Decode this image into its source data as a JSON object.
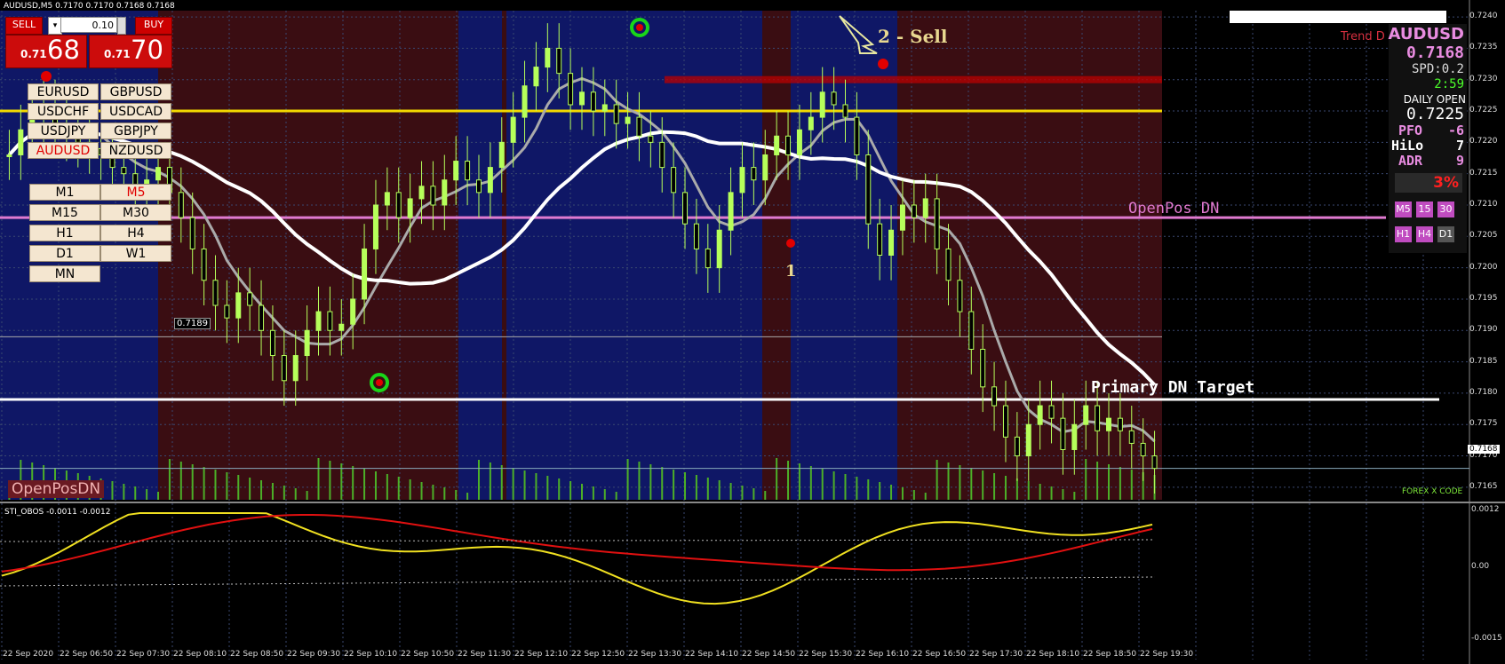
{
  "window": {
    "title": "AUDUSD,M5  0.7170 0.7170 0.7168 0.7168"
  },
  "trade_panel": {
    "sell_label": "SELL",
    "buy_label": "BUY",
    "lot": "0.10",
    "sell_small": "0.71",
    "sell_big": "68",
    "buy_small": "0.71",
    "buy_big": "70"
  },
  "currency_buttons": [
    "EURUSD",
    "GBPUSD",
    "USDCHF",
    "USDCAD",
    "USDJPY",
    "GBPJPY",
    "AUDUSD",
    "NZDUSD"
  ],
  "timeframe_buttons": [
    "M1",
    "M5",
    "M15",
    "M30",
    "H1",
    "H4",
    "D1",
    "W1",
    "MN"
  ],
  "selected_currency": "AUDUSD",
  "selected_timeframe": "M5",
  "price_axis": [
    "0.7240",
    "0.7235",
    "0.7230",
    "0.7225",
    "0.7220",
    "0.7215",
    "0.7210",
    "0.7205",
    "0.7200",
    "0.7195",
    "0.7190",
    "0.7185",
    "0.7180",
    "0.7175",
    "0.7170",
    "0.7165"
  ],
  "current_price_tag": "0.7168",
  "level_tag": "0.7189",
  "time_axis": [
    "22 Sep 2020",
    "22 Sep 06:50",
    "22 Sep 07:30",
    "22 Sep 08:10",
    "22 Sep 08:50",
    "22 Sep 09:30",
    "22 Sep 10:10",
    "22 Sep 10:50",
    "22 Sep 11:30",
    "22 Sep 12:10",
    "22 Sep 12:50",
    "22 Sep 13:30",
    "22 Sep 14:10",
    "22 Sep 14:50",
    "22 Sep 15:30",
    "22 Sep 16:10",
    "22 Sep 16:50",
    "22 Sep 17:30",
    "22 Sep 18:10",
    "22 Sep 18:50",
    "22 Sep 19:30"
  ],
  "annotations": {
    "sell": "2 - Sell",
    "one": "1",
    "openpos": "OpenPos DN",
    "primary": "Primary DN Target",
    "trend": "Trend D",
    "openpos_badge": "OpenPosDN",
    "brand": "FOREX X CODE"
  },
  "info_panel": {
    "symbol": "AUDUSD",
    "price": "0.7168",
    "spread": "SPD:0.2",
    "timer": "2:59",
    "daily_open_label": "DAILY OPEN",
    "daily_open": "0.7225",
    "pfo_label": "PFO",
    "pfo": "-6",
    "hilo_label": "HiLo",
    "hilo": "7",
    "adr_label": "ADR",
    "adr": "9",
    "percent": "3%",
    "tf_row1": [
      "M5",
      "15",
      "30"
    ],
    "tf_row2": [
      "H1",
      "H4",
      "D1"
    ]
  },
  "indicator": {
    "label": "STI_OBOS -0.0011 -0.0012",
    "axis": [
      "0.0012",
      "0.00",
      "-0.0015"
    ]
  },
  "colors": {
    "bg": "#000000",
    "dark_red_zone": "#3a0d12",
    "blue_zone": "#0f1766",
    "bull": "#b6ff5a",
    "yellow_line": "#f2d800",
    "magenta_line": "#e07ad0",
    "red_dot": "#e00000",
    "green_ring": "#19d619"
  },
  "chart_data": {
    "type": "candlestick",
    "symbol": "AUDUSD",
    "timeframe": "M5",
    "ylim": [
      0.7163,
      0.7241
    ],
    "close_series": [
      0.7218,
      0.7222,
      0.7224,
      0.7226,
      0.7223,
      0.7221,
      0.722,
      0.7219,
      0.7218,
      0.7216,
      0.7215,
      0.7213,
      0.7214,
      0.7216,
      0.7212,
      0.7208,
      0.7203,
      0.7198,
      0.7194,
      0.7192,
      0.7196,
      0.7194,
      0.719,
      0.7186,
      0.7182,
      0.7186,
      0.719,
      0.7193,
      0.719,
      0.7191,
      0.7195,
      0.7203,
      0.721,
      0.7212,
      0.7208,
      0.7211,
      0.7213,
      0.721,
      0.7214,
      0.7217,
      0.7214,
      0.7212,
      0.7216,
      0.722,
      0.7224,
      0.7229,
      0.7232,
      0.7235,
      0.7231,
      0.7226,
      0.7228,
      0.7225,
      0.7226,
      0.7223,
      0.7224,
      0.7221,
      0.722,
      0.7216,
      0.7212,
      0.7207,
      0.7203,
      0.72,
      0.7206,
      0.7212,
      0.7216,
      0.7214,
      0.7218,
      0.7221,
      0.7218,
      0.7222,
      0.7224,
      0.7228,
      0.7226,
      0.7224,
      0.7218,
      0.7207,
      0.7202,
      0.7206,
      0.721,
      0.7208,
      0.7211,
      0.7203,
      0.7198,
      0.7193,
      0.7187,
      0.7181,
      0.7178,
      0.7173,
      0.717,
      0.7175,
      0.7178,
      0.7176,
      0.7171,
      0.7175,
      0.7178,
      0.7174,
      0.7176,
      0.7174,
      0.7172,
      0.717,
      0.7168
    ],
    "levels": {
      "daily_open": 0.7225,
      "open_pos_dn": 0.7208,
      "primary_dn_target": 0.7179,
      "resistance_band": 0.723
    }
  }
}
